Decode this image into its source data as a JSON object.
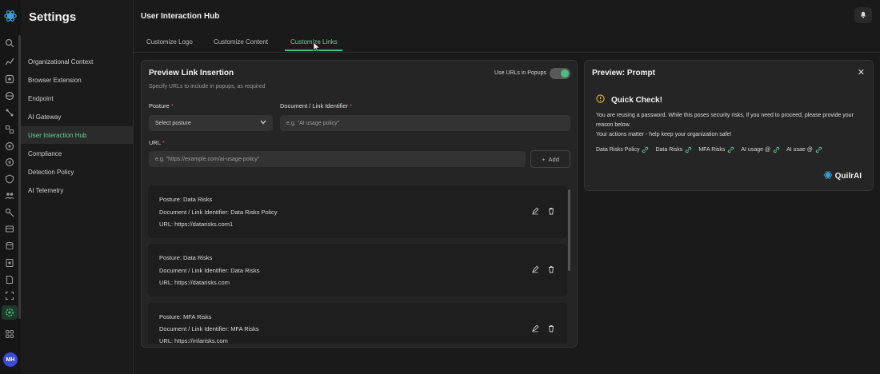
{
  "colors": {
    "accent": "#45c07f",
    "background": "#1a1a1a",
    "card": "#252525",
    "required": "#e05a5a",
    "avatar": "#3a4bd6",
    "warning": "#f0b429"
  },
  "rail": {
    "icons": [
      "logo-icon",
      "search-icon",
      "chart-icon",
      "users-icon",
      "globe-icon",
      "network-icon",
      "link-icon",
      "circle-icon",
      "server-icon",
      "shield-icon",
      "puzzle-icon",
      "group-icon",
      "key-icon",
      "cloud-icon",
      "database-icon",
      "certificate-icon",
      "file-icon",
      "scan-icon",
      "settings-icon",
      "grid-icon"
    ],
    "avatar_initials": "MH"
  },
  "sidebar": {
    "title": "Settings",
    "items": [
      {
        "label": "Organizational Context"
      },
      {
        "label": "Browser Extension"
      },
      {
        "label": "Endpoint"
      },
      {
        "label": "AI Gateway"
      },
      {
        "label": "User Interaction Hub"
      },
      {
        "label": "Compliance"
      },
      {
        "label": "Detection Policy"
      },
      {
        "label": "AI Telemetry"
      }
    ],
    "active_index": 4
  },
  "header": {
    "title": "User Interaction Hub",
    "tabs": [
      {
        "label": "Customize Logo"
      },
      {
        "label": "Customize Content"
      },
      {
        "label": "Customize Links"
      }
    ],
    "active_tab": 2
  },
  "link_form": {
    "title": "Preview Link Insertion",
    "subtitle": "Specify URLs to include in popups, as required",
    "toggle_label": "Use URLs in Popups",
    "toggle_on": true,
    "posture": {
      "label": "Posture",
      "required_mark": "*",
      "value": "Select posture"
    },
    "identifier": {
      "label": "Document / Link Identifier",
      "required_mark": "*",
      "placeholder": "e.g. \"AI usage policy\""
    },
    "url": {
      "label": "URL",
      "required_mark": "*",
      "placeholder": "e.g. \"https://example.com/ai-usage-policy\""
    },
    "add_button": {
      "icon": "plus-icon",
      "label": "Add"
    }
  },
  "entries": [
    {
      "posture": "Posture: Data Risks",
      "identifier": "Document / Link Identifier: Data Risks Policy",
      "url": "URL: https://datarisks.com1"
    },
    {
      "posture": "Posture: Data Risks",
      "identifier": "Document / Link Identifier: Data Risks",
      "url": "URL: https://datarisks.com"
    },
    {
      "posture": "Posture: MFA Risks",
      "identifier": "Document / Link Identifier: MFA Risks",
      "url": "URL: https://mfarisks.com"
    }
  ],
  "preview": {
    "title": "Preview: Prompt",
    "close_icon": "close-icon",
    "heading": "Quick Check!",
    "warning_icon": "warning-icon",
    "message_line1": "You are reusing a password. While this poses security risks, if you need to proceed, please provide your reason below.",
    "message_line2": "Your actions matter - help keep your organization safe!",
    "links": [
      "Data Risks Policy",
      "Data Risks",
      "MFA Risks",
      "AI usage @",
      "AI usae @"
    ],
    "brand": "QuilrAI"
  }
}
